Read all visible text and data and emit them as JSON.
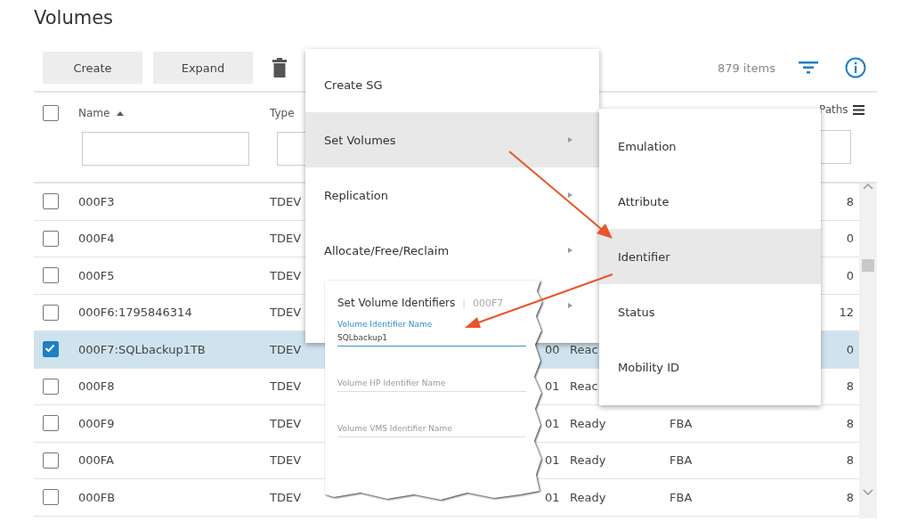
{
  "page_title": "Volumes",
  "toolbar": {
    "buttons": [
      "Create",
      "Expand"
    ],
    "item_count": "879 items"
  },
  "table": {
    "select_all_checked": false,
    "columns": [
      {
        "label": "Name",
        "sorted_ascending": true
      },
      {
        "label": "Type"
      },
      {
        "label": "Paths"
      }
    ],
    "rows": [
      {
        "name": "000F3",
        "type": "TDEV",
        "paths": "8",
        "selected": false
      },
      {
        "name": "000F4",
        "type": "TDEV",
        "paths": "0",
        "selected": false
      },
      {
        "name": "000F5",
        "type": "TDEV",
        "paths": "0",
        "selected": false
      },
      {
        "name": "000F6:1795846314",
        "type": "TDEV",
        "paths": "12",
        "selected": false
      },
      {
        "name": "000F7:SQLbackup1TB",
        "type": "TDEV",
        "column_4": "00",
        "status": "Reac",
        "paths": "0",
        "selected": true
      },
      {
        "name": "000F8",
        "type": "TDEV",
        "column_4": "01",
        "status": "Reac",
        "paths": "8",
        "selected": false
      },
      {
        "name": "000F9",
        "type": "TDEV",
        "column_4": "01",
        "status": "Ready",
        "emulation": "FBA",
        "paths": "8",
        "selected": false
      },
      {
        "name": "000FA",
        "type": "TDEV",
        "column_4": "01",
        "status": "Ready",
        "emulation": "FBA",
        "paths": "8",
        "selected": false
      },
      {
        "name": "000FB",
        "type": "TDEV",
        "column_4": "01",
        "status": "Ready",
        "emulation": "FBA",
        "paths": "8",
        "selected": false
      }
    ]
  },
  "menu": {
    "items": [
      {
        "label": "Create SG",
        "submenu": false,
        "selected": false
      },
      {
        "label": "Set Volumes",
        "submenu": true,
        "selected": true
      },
      {
        "label": "Replication",
        "submenu": true,
        "selected": false
      },
      {
        "label": "Allocate/Free/Reclaim",
        "submenu": true,
        "selected": false
      },
      {
        "submenu": true,
        "selected": false
      }
    ]
  },
  "submenu": {
    "items": [
      {
        "label": "Emulation",
        "selected": false
      },
      {
        "label": "Attribute",
        "selected": false
      },
      {
        "label": "Identifier",
        "selected": true
      },
      {
        "label": "Status",
        "selected": false
      },
      {
        "label": "Mobility ID",
        "selected": false
      }
    ]
  },
  "dialog": {
    "title": "Set Volume Identifiers",
    "separator": "|",
    "volume": "000F7",
    "fields": [
      {
        "label": "Volume Identifier Name",
        "value": "SQLbackup1"
      },
      {
        "placeholder": "Volume HP Identifier Name"
      },
      {
        "placeholder": "Volume VMS Identifier Name"
      }
    ]
  }
}
